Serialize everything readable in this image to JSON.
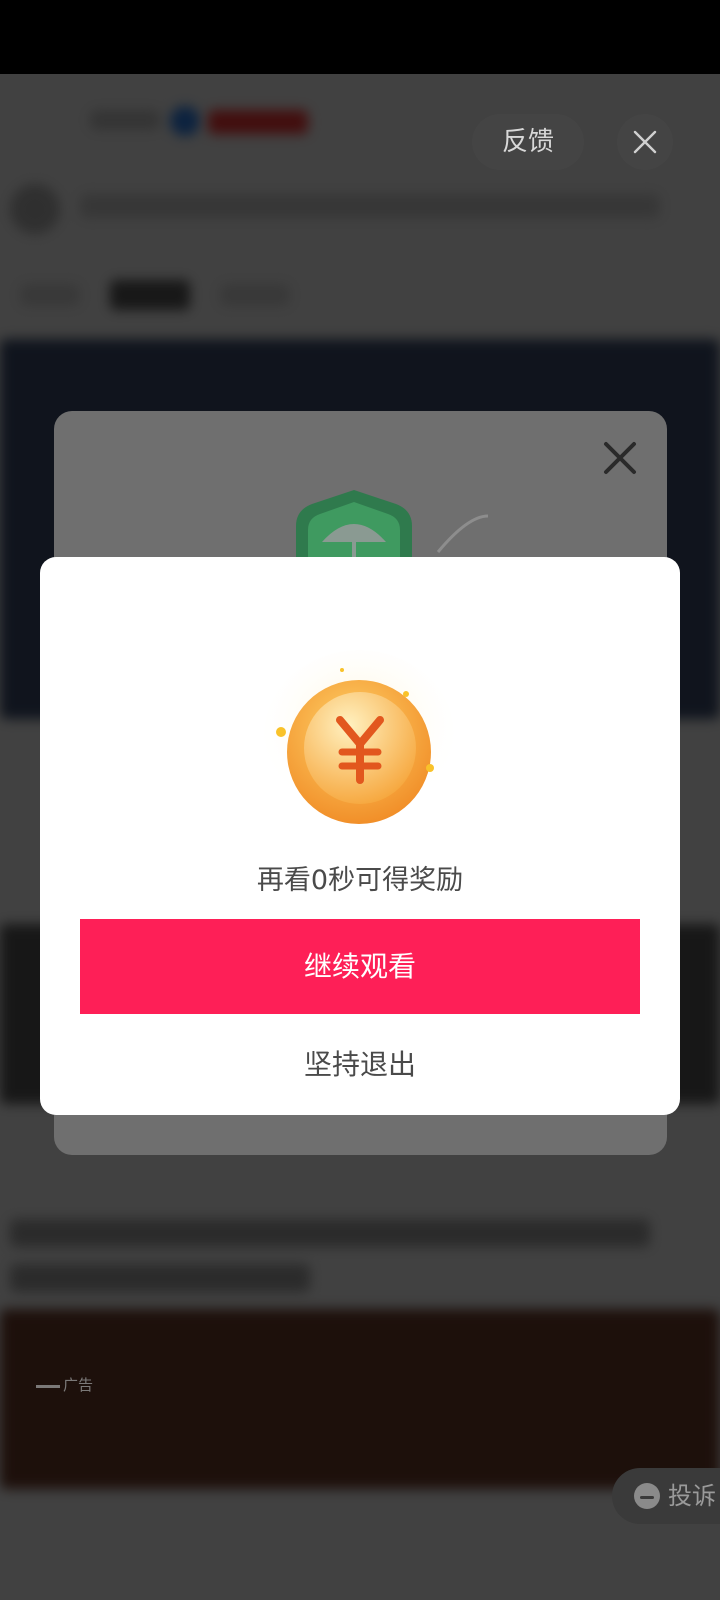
{
  "ad_controls": {
    "feedback_label": "反馈"
  },
  "reward_modal": {
    "message": "再看0秒可得奖励",
    "continue_label": "继续观看",
    "exit_label": "坚持退出"
  },
  "background": {
    "ad_tag_label": "广告"
  },
  "complaint": {
    "label": "投诉"
  },
  "colors": {
    "primary_button": "#fe1f57",
    "coin_orange": "#f6a53a"
  }
}
